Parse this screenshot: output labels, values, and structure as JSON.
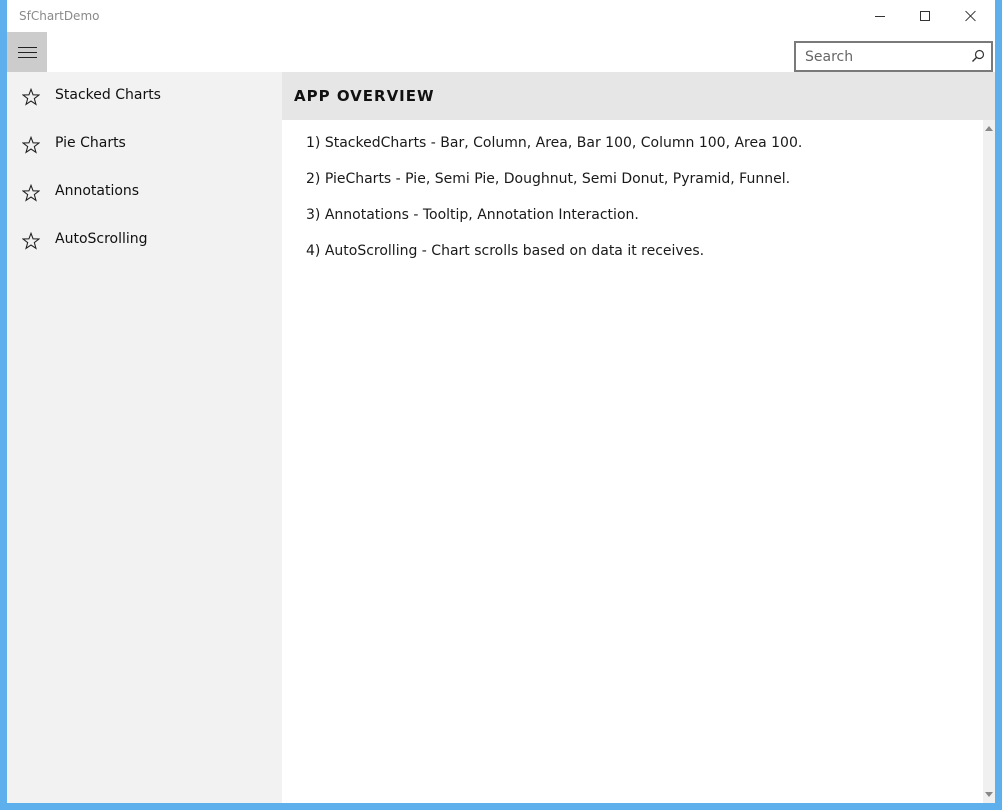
{
  "window": {
    "title": "SfChartDemo"
  },
  "search": {
    "placeholder": "Search",
    "value": ""
  },
  "sidebar": {
    "items": [
      {
        "label": "Stacked Charts",
        "icon": "star-outline-icon"
      },
      {
        "label": "Pie Charts",
        "icon": "star-outline-icon"
      },
      {
        "label": "Annotations",
        "icon": "star-outline-icon"
      },
      {
        "label": "AutoScrolling",
        "icon": "star-outline-icon"
      }
    ]
  },
  "main": {
    "title": "APP OVERVIEW",
    "items": [
      "1) StackedCharts - Bar, Column, Area, Bar 100, Column 100, Area 100.",
      "2) PieCharts - Pie, Semi Pie, Doughnut, Semi Donut, Pyramid, Funnel.",
      "3) Annotations - Tooltip, Annotation Interaction.",
      "4) AutoScrolling - Chart scrolls based on data it receives."
    ]
  },
  "colors": {
    "desktop": "#5eb0ec",
    "sidebar_bg": "#f2f2f2",
    "header_bg": "#e6e6e6",
    "hamburger_bg": "#cccccc"
  }
}
